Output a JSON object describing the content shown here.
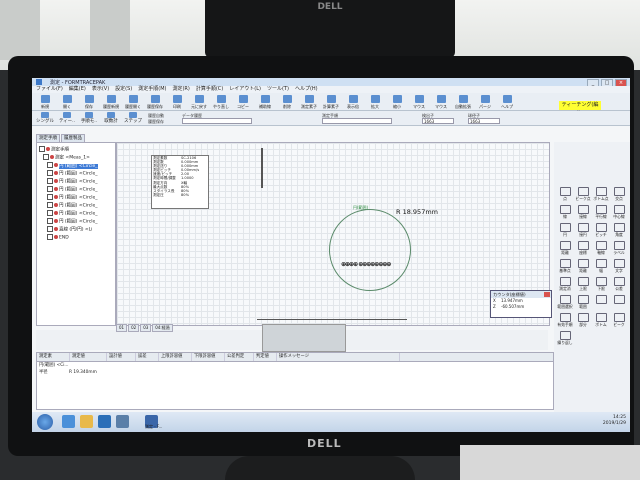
{
  "app": {
    "title": "測定 - FORMTRACEPAK",
    "window_buttons": [
      "_",
      "□",
      "×"
    ]
  },
  "menubar": [
    "ファイル(F)",
    "編集(E)",
    "表示(V)",
    "設定(S)",
    "測定手順(M)",
    "測定(R)",
    "計算手順(C)",
    "レイアウト(L)",
    "ツール(T)",
    "ヘルプ(H)"
  ],
  "toolbar1": [
    {
      "label": "新規",
      "icon": "new-file-icon"
    },
    {
      "label": "開く",
      "icon": "open-folder-icon"
    },
    {
      "label": "保存",
      "icon": "save-icon"
    },
    {
      "label": "履歴新規",
      "icon": "history-new-icon"
    },
    {
      "label": "履歴開く",
      "icon": "history-open-icon"
    },
    {
      "label": "履歴保存",
      "icon": "history-save-icon"
    },
    {
      "label": "印刷",
      "icon": "print-icon"
    },
    {
      "label": "元に戻す",
      "icon": "undo-icon"
    },
    {
      "label": "やり直し",
      "icon": "redo-icon"
    },
    {
      "label": "コピー",
      "icon": "copy-icon"
    },
    {
      "label": "補助線",
      "icon": "guide-line-icon"
    },
    {
      "label": "削除",
      "icon": "delete-icon"
    },
    {
      "label": "測定素子",
      "icon": "element-icon"
    },
    {
      "label": "計算素子",
      "icon": "calc-icon"
    },
    {
      "label": "表示倍",
      "icon": "view-icon"
    },
    {
      "label": "拡大",
      "icon": "zoom-in-icon"
    },
    {
      "label": "縮小",
      "icon": "zoom-out-icon"
    },
    {
      "label": "マウス",
      "icon": "mouse-icon"
    },
    {
      "label": "マウス",
      "icon": "mouse2-icon"
    },
    {
      "label": "自動拡張",
      "icon": "auto-icon"
    },
    {
      "label": "パージ",
      "icon": "purge-icon"
    },
    {
      "label": "ヘルプ",
      "icon": "help-icon"
    }
  ],
  "teaching_badge": "ティーチング(編集)",
  "toolbar2": [
    {
      "label": "シングル"
    },
    {
      "label": "ティー.."
    },
    {
      "label": "手順モ.."
    },
    {
      "label": "取数計"
    },
    {
      "label": "ステップ"
    }
  ],
  "toolbar2_fields": {
    "history_label": "履歴自動",
    "history_save": "履歴保存",
    "data_label": "データ履歴",
    "measure_label": "測定手順",
    "detect_label": "検出子",
    "probe_label": "球径子",
    "combo_value": "1663"
  },
  "tree": {
    "tabs": [
      "測定手順",
      "履歴製品"
    ],
    "rows": [
      {
        "text": "測定手順",
        "selected": false
      },
      {
        "text": "測定 <Meas_1>",
        "selected": false
      },
      {
        "text": "円 (範囲) <Circle_",
        "selected": true
      },
      {
        "text": "円 (範囲) <Circle_",
        "selected": false
      },
      {
        "text": "円 (範囲) <Circle_",
        "selected": false
      },
      {
        "text": "円 (範囲) <Circle_",
        "selected": false
      },
      {
        "text": "円 (範囲) <Circle_",
        "selected": false
      },
      {
        "text": "円 (範囲) <Circle_",
        "selected": false
      },
      {
        "text": "円 (範囲) <Circle_",
        "selected": false
      },
      {
        "text": "円 (範囲) <Circle_",
        "selected": false
      },
      {
        "text": "直線 (円/円) <Li",
        "selected": false
      },
      {
        "text": "END",
        "selected": false
      }
    ]
  },
  "info_box": [
    {
      "k": "測定素数",
      "v": "SC-2106"
    },
    {
      "k": "測定数",
      "v": "0.000mm"
    },
    {
      "k": "測定送り",
      "v": "0.000mm"
    },
    {
      "k": "測定ピッチ",
      "v": "0.00mm/s"
    },
    {
      "k": "速度/ピッチ",
      "v": "2.00"
    },
    {
      "k": "測定時間/調整",
      "v": "1.0000"
    },
    {
      "k": "測定方向",
      "v": "X軸"
    },
    {
      "k": "最大点数",
      "v": "80%"
    },
    {
      "k": "スタイラス長",
      "v": "80%"
    },
    {
      "k": "測定圧",
      "v": "80%"
    }
  ],
  "canvas": {
    "dim_label": "円(範囲)",
    "dim_value": "R 18.957mm"
  },
  "mini_tabs": [
    "01",
    "02",
    "03",
    "04:経過"
  ],
  "counter": {
    "title": "カウンタ(座標値)",
    "rows": [
      {
        "axis": "X",
        "value": "13.947mm"
      },
      {
        "axis": "Z",
        "value": "-60.507mm"
      }
    ]
  },
  "right_tools": [
    "点",
    "ピーク点",
    "ボトム点",
    "交点",
    "線",
    "接線",
    "平行線",
    "中心線",
    "円",
    "接円",
    "ピッチ",
    "角度",
    "距離",
    "座標",
    "軸線",
    "ラベル",
    "基準点",
    "距離",
    "幅",
    "文字",
    "測定消",
    "上限",
    "下限",
    "公差",
    "範囲選択",
    "範囲",
    "",
    "",
    "有効手順",
    "部分",
    "ボトム",
    "ピーク",
    "繰り返し"
  ],
  "result": {
    "headers": [
      "測定素",
      "測定値",
      "設計値",
      "誤差",
      "上限許容値",
      "下限許容値",
      "公差判定",
      "判定値",
      "操作メッセージ"
    ],
    "rows": [
      {
        "name": "円(範囲) <Ci...",
        "value": ""
      },
      {
        "name": "半径",
        "value": "R 19.340mm"
      }
    ]
  },
  "taskbar": {
    "label": "測定 - F...",
    "clock": "14:25",
    "date": "2019/1/29"
  },
  "logos": {
    "back": "DELL",
    "front": "DELL"
  }
}
